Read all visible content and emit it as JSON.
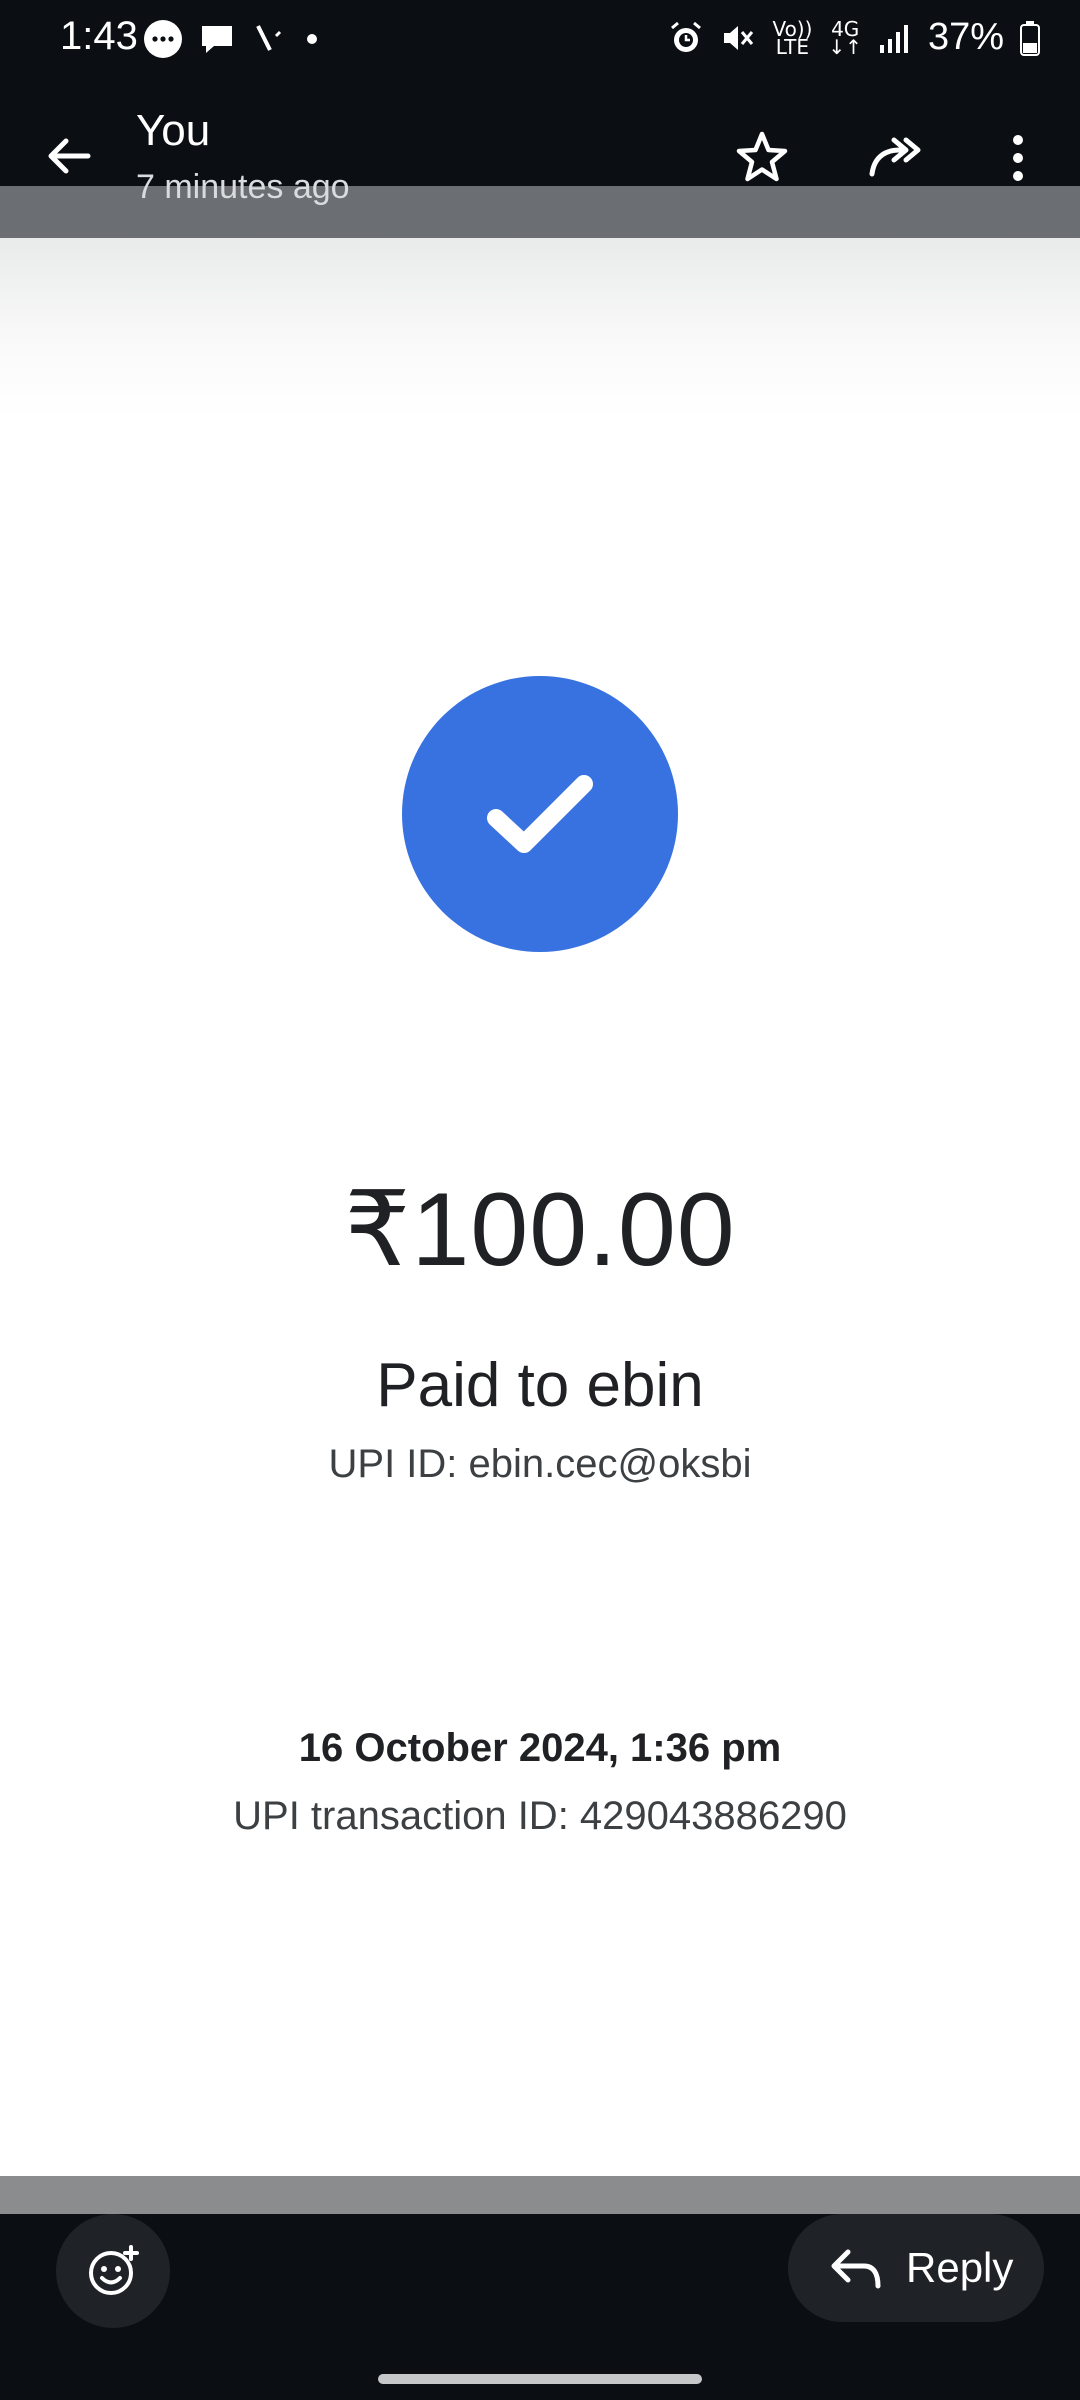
{
  "status_bar": {
    "time": "1:43",
    "network_top": "Vo))",
    "network_bottom": "LTE",
    "data_top": "4G",
    "battery": "37%"
  },
  "app_bar": {
    "title": "You",
    "subtitle": "7 minutes ago"
  },
  "receipt": {
    "amount": "₹100.00",
    "paid_to": "Paid to ebin",
    "upi_id": "UPI ID: ebin.cec@oksbi",
    "datetime": "16 October 2024, 1:36 pm",
    "transaction_id": "UPI transaction ID: 429043886290",
    "accent_color": "#3872e0"
  },
  "bottom_bar": {
    "reply_label": "Reply"
  }
}
